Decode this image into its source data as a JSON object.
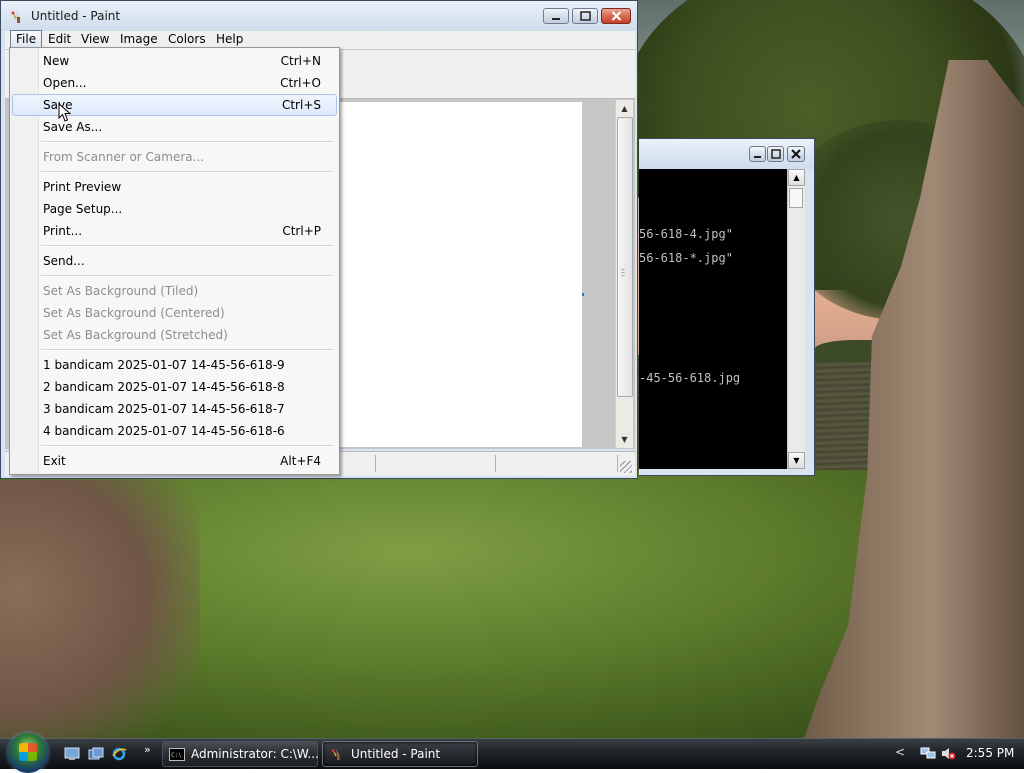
{
  "paint": {
    "title": "Untitled - Paint",
    "menu": [
      "File",
      "Edit",
      "View",
      "Image",
      "Colors",
      "Help"
    ],
    "file_menu": [
      {
        "label": "New",
        "shortcut": "Ctrl+N",
        "enabled": true
      },
      {
        "label": "Open...",
        "shortcut": "Ctrl+O",
        "enabled": true
      },
      {
        "label": "Save",
        "shortcut": "Ctrl+S",
        "enabled": true,
        "highlighted": true
      },
      {
        "label": "Save As...",
        "shortcut": "",
        "enabled": true
      },
      {
        "label": "From Scanner or Camera...",
        "shortcut": "",
        "enabled": false
      },
      {
        "label": "Print Preview",
        "shortcut": "",
        "enabled": true
      },
      {
        "label": "Page Setup...",
        "shortcut": "",
        "enabled": true
      },
      {
        "label": "Print...",
        "shortcut": "Ctrl+P",
        "enabled": true
      },
      {
        "label": "Send...",
        "shortcut": "",
        "enabled": true
      },
      {
        "label": "Set As Background (Tiled)",
        "shortcut": "",
        "enabled": false
      },
      {
        "label": "Set As Background (Centered)",
        "shortcut": "",
        "enabled": false
      },
      {
        "label": "Set As Background (Stretched)",
        "shortcut": "",
        "enabled": false
      },
      {
        "label": "1 bandicam 2025-01-07 14-45-56-618-9",
        "shortcut": "",
        "enabled": true
      },
      {
        "label": "2 bandicam 2025-01-07 14-45-56-618-8",
        "shortcut": "",
        "enabled": true
      },
      {
        "label": "3 bandicam 2025-01-07 14-45-56-618-7",
        "shortcut": "",
        "enabled": true
      },
      {
        "label": "4 bandicam 2025-01-07 14-45-56-618-6",
        "shortcut": "",
        "enabled": true
      },
      {
        "label": "Exit",
        "shortcut": "Alt+F4",
        "enabled": true
      }
    ]
  },
  "cmd": {
    "lines": [
      "56-618-4.jpg\"",
      "56-618-*.jpg\"",
      "-45-56-618.jpg"
    ]
  },
  "taskbar": {
    "buttons": [
      {
        "label": "Administrator: C:\\W...",
        "icon": "cmd-icon"
      },
      {
        "label": "Untitled - Paint",
        "icon": "paint-icon"
      }
    ],
    "quick_launch_more": "»",
    "clock": "2:55 PM"
  },
  "colors": {
    "menu_highlight": "#dde9fb",
    "cmd_background": "#000000",
    "cmd_text": "#c0c0c0",
    "close_button": "#d66a52"
  }
}
